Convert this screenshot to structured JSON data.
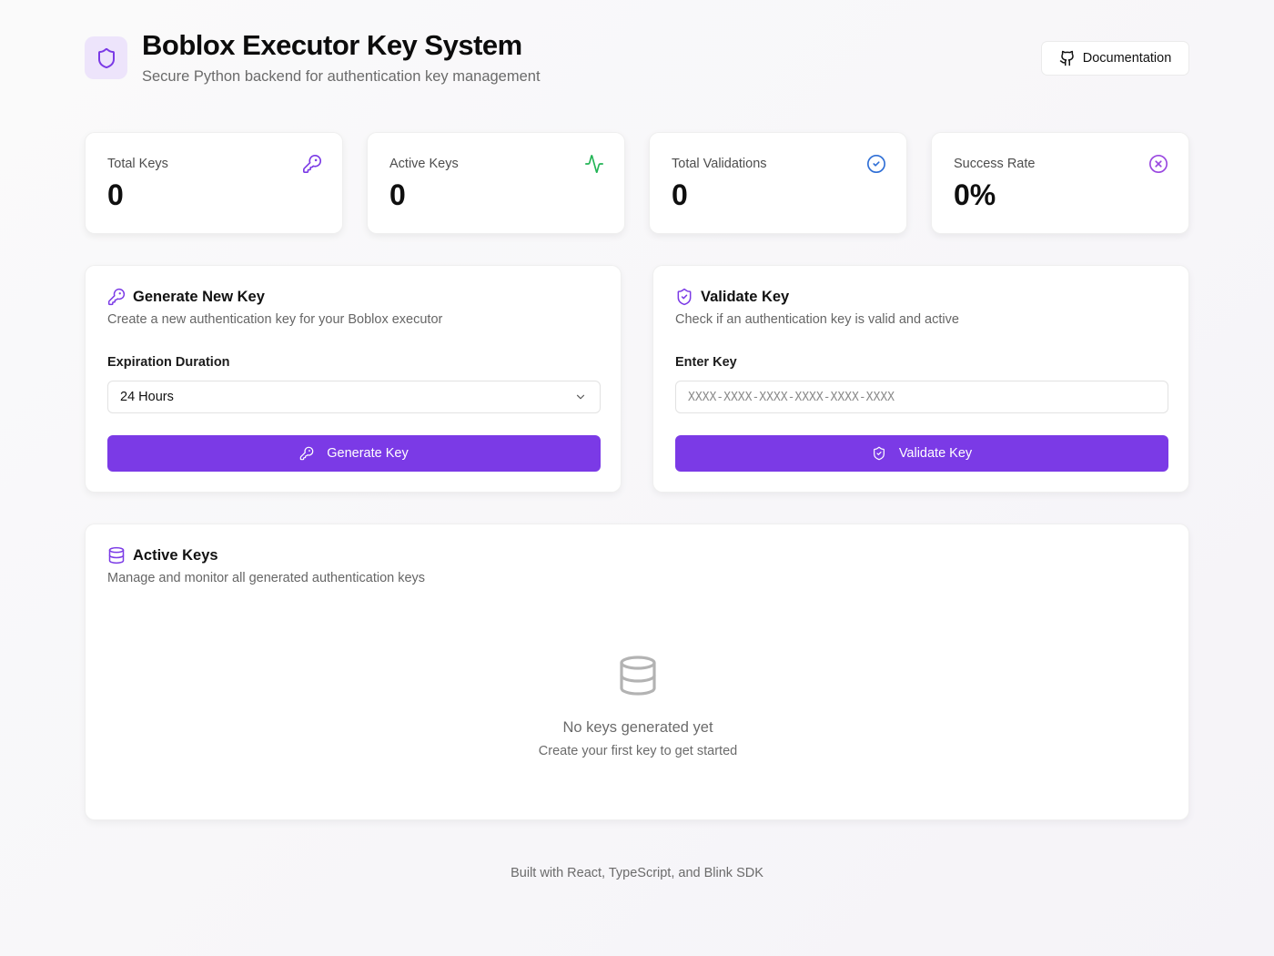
{
  "header": {
    "title": "Boblox Executor Key System",
    "subtitle": "Secure Python backend for authentication key management",
    "doc_button": "Documentation",
    "logo_icon": "shield-icon",
    "doc_icon": "github-icon"
  },
  "stats": [
    {
      "label": "Total Keys",
      "value": "0",
      "icon": "key-icon",
      "color": "#7b3ae6"
    },
    {
      "label": "Active Keys",
      "value": "0",
      "icon": "activity-icon",
      "color": "#22b455"
    },
    {
      "label": "Total Validations",
      "value": "0",
      "icon": "check-circle-icon",
      "color": "#2f6fd6"
    },
    {
      "label": "Success Rate",
      "value": "0%",
      "icon": "x-circle-icon",
      "color": "#9a48e0"
    }
  ],
  "generate": {
    "title": "Generate New Key",
    "description": "Create a new authentication key for your Boblox executor",
    "field_label": "Expiration Duration",
    "selected": "24 Hours",
    "button": "Generate Key"
  },
  "validate": {
    "title": "Validate Key",
    "description": "Check if an authentication key is valid and active",
    "field_label": "Enter Key",
    "placeholder": "XXXX-XXXX-XXXX-XXXX-XXXX-XXXX",
    "value": "",
    "button": "Validate Key"
  },
  "active_keys": {
    "title": "Active Keys",
    "description": "Manage and monitor all generated authentication keys",
    "empty_title": "No keys generated yet",
    "empty_subtitle": "Create your first key to get started"
  },
  "footer": {
    "text": "Built with React, TypeScript, and Blink SDK"
  },
  "colors": {
    "accent": "#7b3ae6",
    "accent_light": "#ede4fb"
  }
}
